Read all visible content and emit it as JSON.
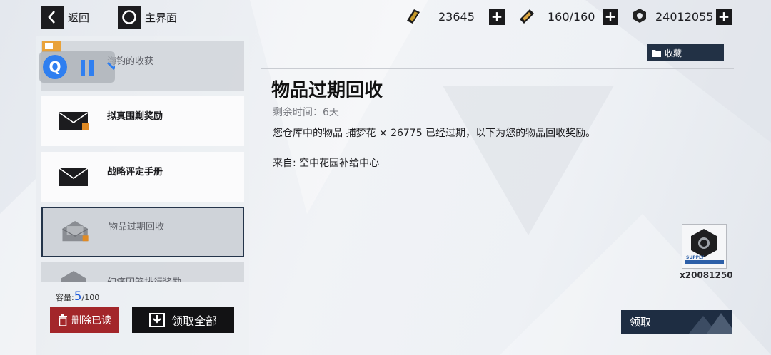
{
  "topbar": {
    "back_label": "返回",
    "home_label": "主界面",
    "resources": [
      {
        "icon": "gold-bar-icon",
        "value": "23645"
      },
      {
        "icon": "stamina-battery-icon",
        "value": "160/160"
      },
      {
        "icon": "hex-nut-icon",
        "value": "24012055"
      }
    ]
  },
  "mail_list": {
    "items": [
      {
        "title": "海钓的收获",
        "read": true
      },
      {
        "title": "拟真围剿奖励",
        "read": false
      },
      {
        "title": "战略评定手册",
        "read": false
      },
      {
        "title": "物品过期回收",
        "read": true,
        "selected": true
      },
      {
        "title": "幻痛囚笼排行奖励",
        "read": true
      }
    ],
    "capacity_label": "容量:",
    "capacity_current": "5",
    "capacity_max": "/100",
    "delete_read_label": "删除已读",
    "claim_all_label": "领取全部"
  },
  "detail": {
    "favorite_label": "收藏",
    "title": "物品过期回收",
    "remaining": "剩余时间：6天",
    "body": "您仓库中的物品 捕梦花 × 26775 已经过期，以下为您的物品回收奖励。",
    "from": "来自: 空中花园补给中心",
    "reward": {
      "icon": "hex-nut-supply-icon",
      "count": "x20081250",
      "tag": "SUPPLY"
    },
    "claim_label": "领取"
  },
  "colors": {
    "accent_red": "#a3262a",
    "panel_navy": "#1e2d42",
    "capacity_blue": "#1f5bd8"
  }
}
